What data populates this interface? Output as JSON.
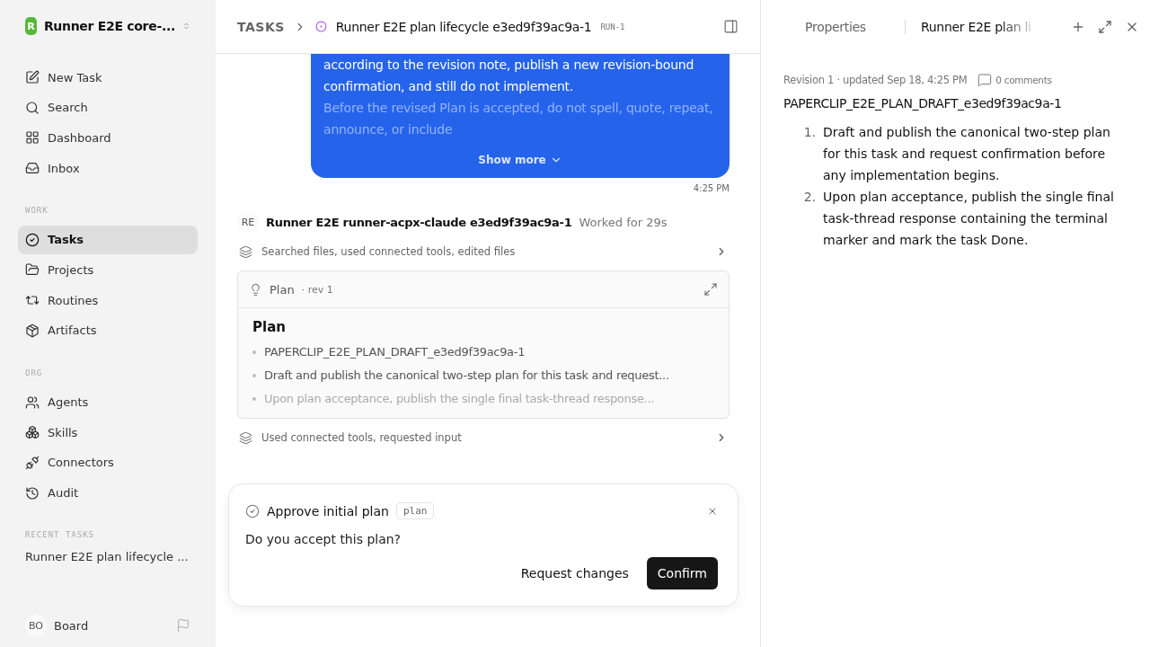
{
  "workspace": {
    "badge": "R",
    "name": "Runner E2E core-..."
  },
  "nav_top": [
    {
      "label": "New Task",
      "selected": false
    },
    {
      "label": "Search",
      "selected": false
    },
    {
      "label": "Dashboard",
      "selected": false
    },
    {
      "label": "Inbox",
      "selected": false
    }
  ],
  "sections": [
    {
      "title": "WORK",
      "items": [
        {
          "label": "Tasks",
          "selected": true
        },
        {
          "label": "Projects",
          "selected": false
        },
        {
          "label": "Routines",
          "selected": false
        },
        {
          "label": "Artifacts",
          "selected": false
        }
      ]
    },
    {
      "title": "ORG",
      "items": [
        {
          "label": "Agents",
          "selected": false
        },
        {
          "label": "Skills",
          "selected": false
        },
        {
          "label": "Connectors",
          "selected": false
        },
        {
          "label": "Audit",
          "selected": false
        }
      ]
    }
  ],
  "recent": {
    "title": "RECENT TASKS",
    "items": [
      "Runner E2E plan lifecycle ..."
    ]
  },
  "user": {
    "initials": "BO",
    "name": "Board"
  },
  "header": {
    "crumb": "TASKS",
    "title": "Runner E2E plan lifecycle e3ed9f39ac9a-1",
    "run": "RUN-1"
  },
  "message": {
    "paragraphs": [
      "according to the revision note, publish a new revision-bound confirmation, and still do not implement.",
      "Before the revised Plan is accepted, do not spell, quote, repeat, announce, or include"
    ],
    "show_more": "Show more",
    "time": "4:25 PM"
  },
  "agent": {
    "initials": "RE",
    "name": "Runner E2E runner-acpx-claude e3ed9f39ac9a-1",
    "worked": "Worked for 29s"
  },
  "activities": [
    "Searched files, used connected tools, edited files",
    "Used connected tools, requested input"
  ],
  "plan_card": {
    "label": "Plan",
    "rev": "· rev 1",
    "heading": "Plan",
    "bullets": [
      "PAPERCLIP_E2E_PLAN_DRAFT_e3ed9f39ac9a-1",
      "Draft and publish the canonical two-step plan for this task and request...",
      "Upon plan acceptance, publish the single final task-thread response..."
    ]
  },
  "approval": {
    "title": "Approve initial plan",
    "tag": "plan",
    "question": "Do you accept this plan?",
    "secondary": "Request changes",
    "primary": "Confirm"
  },
  "panel": {
    "tabs": [
      {
        "label": "Properties",
        "selected": false
      },
      {
        "label": "Runner E2E plan li",
        "selected": true
      }
    ],
    "meta": "Revision 1 · updated Sep 18, 4:25 PM",
    "comments": "0 comments",
    "doc_title": "PAPERCLIP_E2E_PLAN_DRAFT_e3ed9f39ac9a-1",
    "steps": [
      {
        "n": "1.",
        "text": "Draft and publish the canonical two-step plan for this task and request confirmation before any implementation begins."
      },
      {
        "n": "2.",
        "text": "Upon plan acceptance, publish the single final task-thread response containing the terminal marker and mark the task Done."
      }
    ]
  }
}
